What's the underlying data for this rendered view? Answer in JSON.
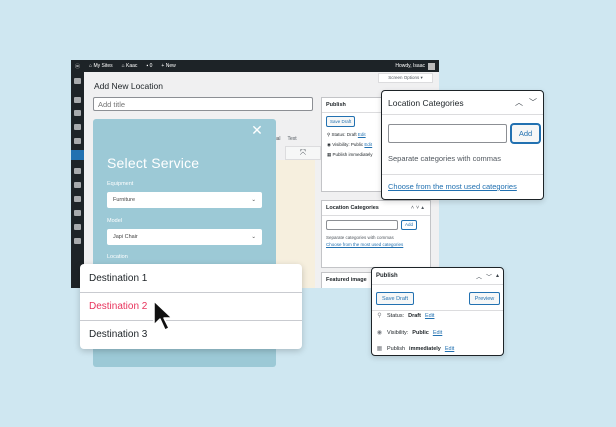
{
  "adminbar": {
    "my_sites": "My Sites",
    "site_name": "Kaac",
    "comments": "0",
    "new": "New",
    "howdy": "Howdy, Isaac"
  },
  "screen_options": "Screen Options ▾",
  "page_title": "Add New Location",
  "title_placeholder": "Add title",
  "editor_tabs": [
    "Visual",
    "Text"
  ],
  "wp_publish": {
    "title": "Publish",
    "save_draft": "Save Draft",
    "status_label": "Status:",
    "status": "Draft",
    "visibility_label": "Visibility:",
    "visibility": "Public",
    "publish_label": "Publish",
    "publish_when": "immediately",
    "edit": "Edit"
  },
  "wp_location_categories": {
    "title": "Location Categories",
    "add": "Add",
    "hint": "Separate categories with commas",
    "link": "Choose from the most used categories"
  },
  "wp_featured_image": {
    "title": "Featured image"
  },
  "modal": {
    "title": "Select Service",
    "equipment_label": "Equipment",
    "equipment_value": "Furniture",
    "model_label": "Model",
    "model_value": "Japi Chair",
    "location_label": "Location"
  },
  "dropdown": {
    "items": [
      "Destination 1",
      "Destination 2",
      "Destination 3"
    ],
    "selected_index": 1
  },
  "location_categories_card": {
    "title": "Location Categories",
    "add_label": "Add",
    "hint": "Separate categories with commas",
    "link": "Choose from the most used categories"
  },
  "publish_card": {
    "title": "Publish",
    "save_draft": "Save Draft",
    "preview": "Preview",
    "status_label": "Status:",
    "status_value": "Draft",
    "visibility_label": "Visibility:",
    "visibility_value": "Public",
    "publish_label": "Publish",
    "publish_value": "immediately",
    "edit": "Edit"
  },
  "colors": {
    "background": "#cfe7f1",
    "modal": "#9cc9d6",
    "accent_link": "#2271b1",
    "selected_item": "#e8335c",
    "admin_bar": "#1d2327"
  }
}
